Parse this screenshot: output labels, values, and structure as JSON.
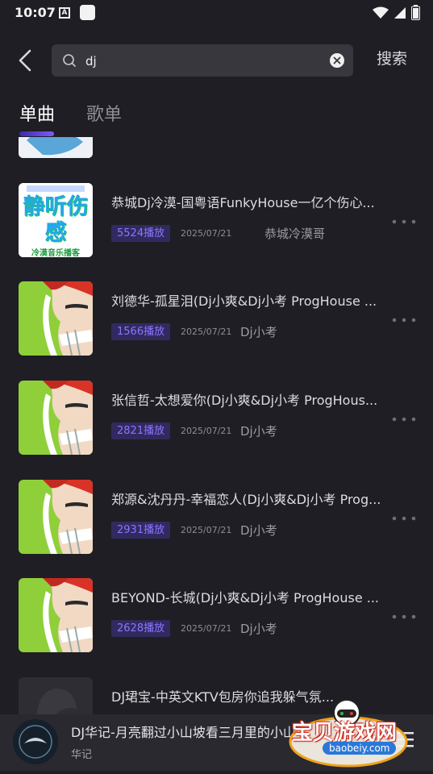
{
  "status_bar": {
    "time": "10:07",
    "a_badge": "A"
  },
  "search": {
    "query": "dj",
    "button_label": "搜索"
  },
  "tabs": [
    {
      "label": "单曲",
      "active": true
    },
    {
      "label": "歌单",
      "active": false
    }
  ],
  "songs": [
    {
      "title": "恭城Dj冷漠-国粤语FunkyHouse一亿个伤心...",
      "plays": "5524播放",
      "date": "2025/07/21",
      "artist": "恭城冷漠哥",
      "cover": "静听伤感",
      "cover_sub": "冷漠音乐播客"
    },
    {
      "title": "刘德华-孤星泪(Dj小爽&Dj小考 ProgHouse ...",
      "plays": "1566播放",
      "date": "2025/07/21",
      "artist": "Dj小考"
    },
    {
      "title": "张信哲-太想爱你(Dj小爽&Dj小考 ProgHous...",
      "plays": "2821播放",
      "date": "2025/07/21",
      "artist": "Dj小考"
    },
    {
      "title": "郑源&沈丹丹-幸福恋人(Dj小爽&Dj小考 Prog...",
      "plays": "2931播放",
      "date": "2025/07/21",
      "artist": "Dj小考"
    },
    {
      "title": "BEYOND-长城(Dj小爽&Dj小考 ProgHouse ...",
      "plays": "2628播放",
      "date": "2025/07/21",
      "artist": "Dj小考"
    },
    {
      "title": "DJ珺宝-中英文KTV包房你追我躲气氛...",
      "plays": "",
      "date": "",
      "artist": ""
    }
  ],
  "player": {
    "title": "DJ华记-月亮翻过小山坡看三月里的小山楂",
    "artist": "华记"
  },
  "watermark": {
    "text": "宝贝游戏网",
    "url": "baobeiy.com"
  },
  "colors": {
    "accent": "#7c5cff",
    "badge_bg": "#312a5e",
    "background": "#1f1e24"
  }
}
